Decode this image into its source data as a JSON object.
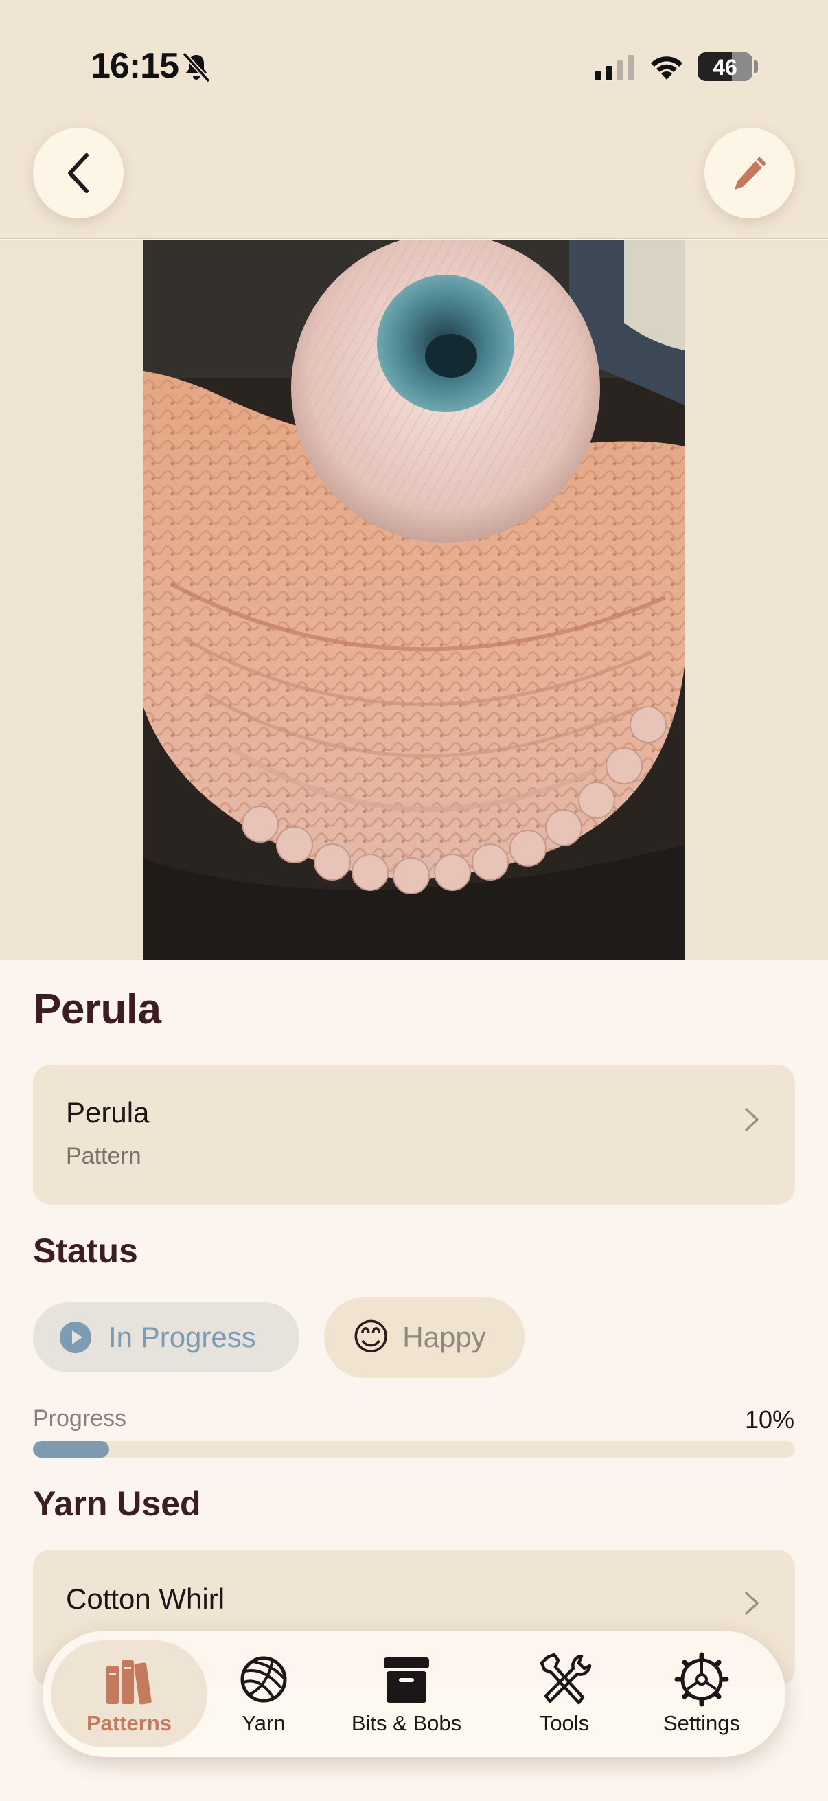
{
  "status_bar": {
    "time": "16:15",
    "battery": "46"
  },
  "project": {
    "title": "Perula",
    "pattern_name": "Perula",
    "pattern_kind": "Pattern"
  },
  "status": {
    "heading": "Status",
    "state": "In Progress",
    "mood_emoji": "😊",
    "mood": "Happy"
  },
  "progress": {
    "label": "Progress",
    "percent_text": "10%",
    "fraction": 0.1
  },
  "yarn": {
    "heading": "Yarn Used",
    "items": [
      {
        "name": "Cotton Whirl"
      }
    ]
  },
  "tabs": [
    {
      "label": "Patterns",
      "icon": "books-icon",
      "active": true
    },
    {
      "label": "Yarn",
      "icon": "yarn-ball-icon",
      "active": false
    },
    {
      "label": "Bits & Bobs",
      "icon": "archive-box-icon",
      "active": false
    },
    {
      "label": "Tools",
      "icon": "tools-icon",
      "active": false
    },
    {
      "label": "Settings",
      "icon": "gear-icon",
      "active": false
    }
  ],
  "colors": {
    "accent": "#c47a5c",
    "progress_fill": "#7e9ab0",
    "background": "#fcf4ee",
    "card": "#f0e4d3"
  }
}
